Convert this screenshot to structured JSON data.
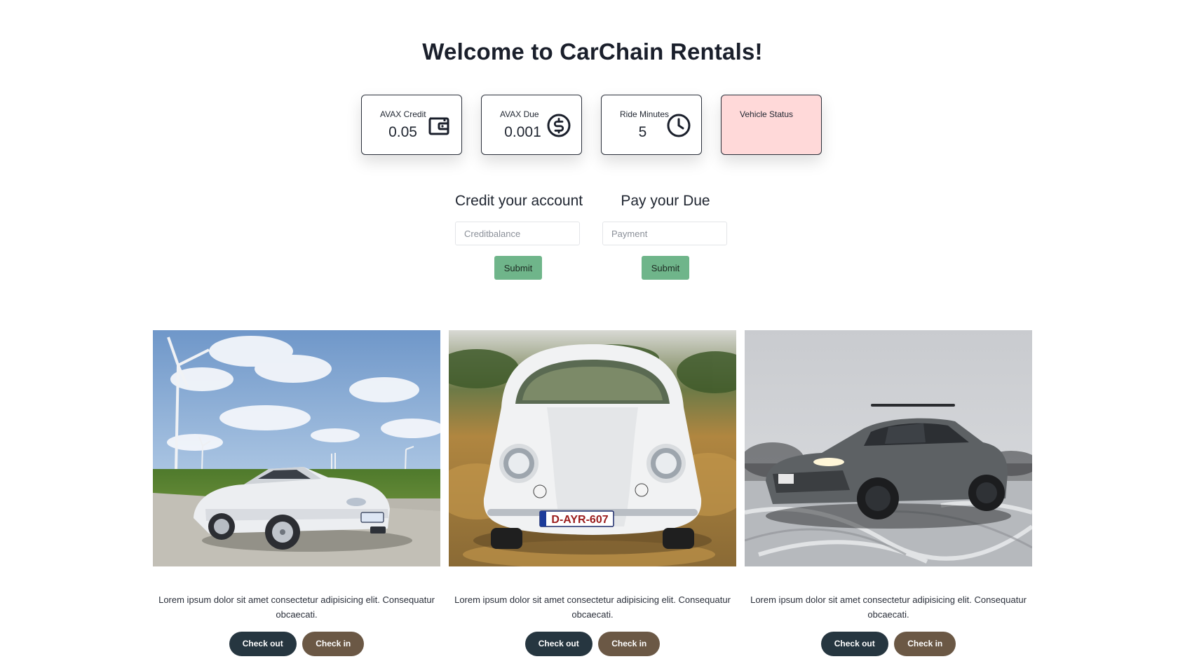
{
  "header": {
    "title": "Welcome to CarChain Rentals!"
  },
  "stats": [
    {
      "label": "AVAX Credit",
      "value": "0.05",
      "icon": "wallet-icon"
    },
    {
      "label": "AVAX Due",
      "value": "0.001",
      "icon": "dollar-circle-icon"
    },
    {
      "label": "Ride Minutes",
      "value": "5",
      "icon": "clock-icon"
    },
    {
      "label": "Vehicle Status",
      "value": "",
      "color": "#ffd9d9"
    }
  ],
  "credit_form": {
    "heading": "Credit your account",
    "placeholder": "Creditbalance",
    "submit_label": "Submit"
  },
  "pay_form": {
    "heading": "Pay your Due",
    "placeholder": "Payment",
    "submit_label": "Submit"
  },
  "cars": [
    {
      "description": "Lorem ipsum dolor sit amet consectetur adipisicing elit. Consequatur obcaecati.",
      "checkout_label": "Check out",
      "checkin_label": "Check in",
      "plate": ""
    },
    {
      "description": "Lorem ipsum dolor sit amet consectetur adipisicing elit. Consequatur obcaecati.",
      "checkout_label": "Check out",
      "checkin_label": "Check in",
      "plate": "D-AYR-607"
    },
    {
      "description": "Lorem ipsum dolor sit amet consectetur adipisicing elit. Consequatur obcaecati.",
      "checkout_label": "Check out",
      "checkin_label": "Check in",
      "plate": ""
    }
  ],
  "colors": {
    "submit": "#6fb58a",
    "checkout": "#263640",
    "checkin": "#6b5845",
    "status_card": "#ffd9d9"
  }
}
